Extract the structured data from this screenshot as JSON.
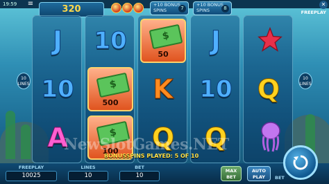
{
  "topbar": {
    "time": "19:59",
    "menu_icon": "≡",
    "close_icon": "✕",
    "mode": "FREEPLAY"
  },
  "header": {
    "win_total": "320",
    "bonus_badges": [
      {
        "text": "+10 BONUS SPINS",
        "count": "7"
      },
      {
        "text": "+10 BONUS SPINS",
        "count": "8"
      }
    ],
    "lines_left": "10 LINES",
    "lines_right": "10 LINES"
  },
  "reels": [
    [
      {
        "sym": "J"
      },
      {
        "sym": "10"
      },
      {
        "sym": "A"
      }
    ],
    [
      {
        "sym": "10"
      },
      {
        "sym": "cash",
        "value": "500"
      },
      {
        "sym": "cash",
        "value": "100"
      }
    ],
    [
      {
        "sym": "cash",
        "value": "50"
      },
      {
        "sym": "K"
      },
      {
        "sym": "Q"
      }
    ],
    [
      {
        "sym": "J"
      },
      {
        "sym": "10"
      },
      {
        "sym": "Q"
      }
    ],
    [
      {
        "sym": "starfish"
      },
      {
        "sym": "Q"
      },
      {
        "sym": "jellyfish"
      }
    ]
  ],
  "message": "BONUSSPINS PLAYED: 5 OF 10",
  "watermark": "NewSlotGames.NET",
  "footer": {
    "freeplay_label": "FREEPLAY",
    "freeplay_value": "10025",
    "lines_label": "LINES",
    "lines_value": "10",
    "bet_label": "BET",
    "bet_value": "10",
    "maxbet_label": "MAX BET",
    "autoplay_label": "AUTO PLAY",
    "bet_side_label": "BET"
  },
  "colors": {
    "accent_gold": "#ffd84a",
    "panel": "#0f4a73",
    "cash_orange": "#e0541f"
  }
}
